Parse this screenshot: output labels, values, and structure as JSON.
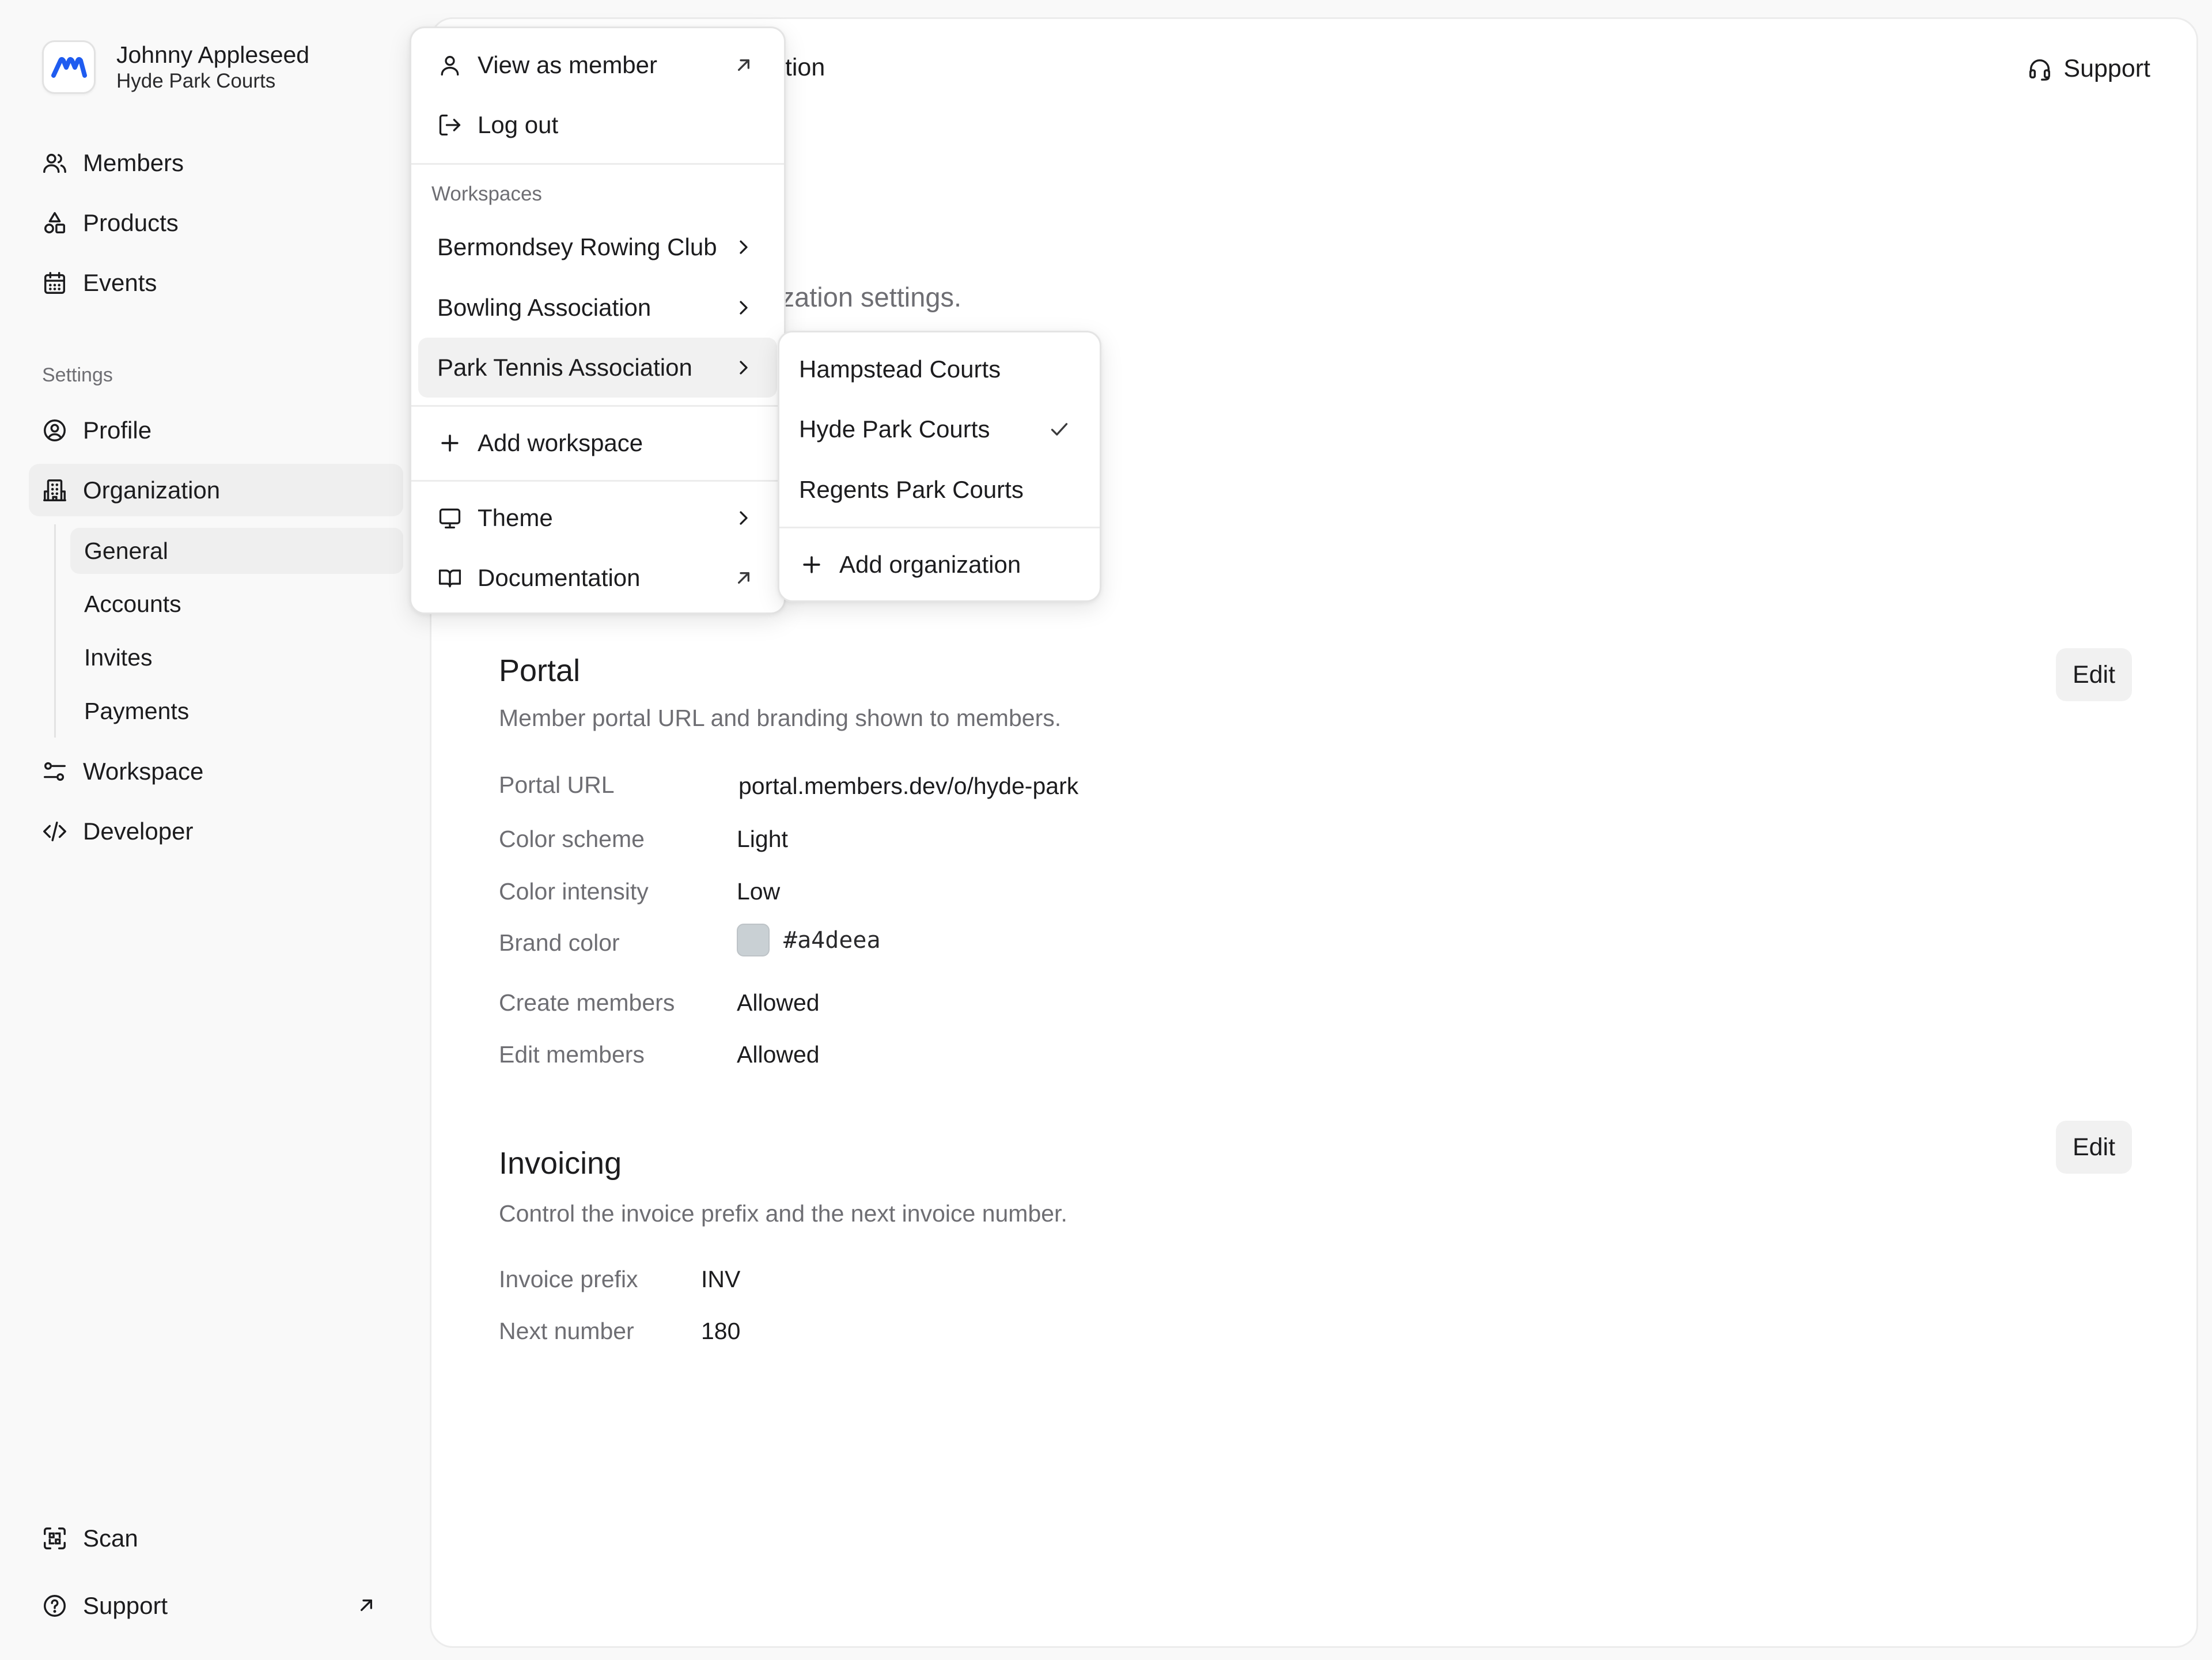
{
  "account": {
    "name": "Johnny Appleseed",
    "organization": "Hyde Park Courts"
  },
  "sidebar": {
    "nav": [
      {
        "label": "Members",
        "icon": "users-icon"
      },
      {
        "label": "Products",
        "icon": "shapes-icon"
      },
      {
        "label": "Events",
        "icon": "calendar-icon"
      }
    ],
    "settings_label": "Settings",
    "settings": [
      {
        "label": "Profile",
        "icon": "user-circle-icon"
      },
      {
        "label": "Organization",
        "icon": "building-icon"
      },
      {
        "label": "Workspace",
        "icon": "sliders-icon"
      },
      {
        "label": "Developer",
        "icon": "code-icon"
      }
    ],
    "org_subnav": [
      "General",
      "Accounts",
      "Invites",
      "Payments"
    ],
    "footer": [
      {
        "label": "Scan",
        "icon": "scan-icon"
      },
      {
        "label": "Support",
        "icon": "help-circle-icon"
      }
    ]
  },
  "topbar": {
    "title_visible": "ation",
    "support_label": "Support"
  },
  "page": {
    "subtitle_visible": "nization settings."
  },
  "portal": {
    "title": "Portal",
    "description": "Member portal URL and branding shown to members.",
    "edit_label": "Edit",
    "rows": [
      {
        "label": "Portal URL",
        "value": "portal.members.dev/o/hyde-park"
      },
      {
        "label": "Color scheme",
        "value": "Light"
      },
      {
        "label": "Color intensity",
        "value": "Low"
      },
      {
        "label": "Brand color",
        "value": "#a4deea"
      },
      {
        "label": "Create members",
        "value": "Allowed"
      },
      {
        "label": "Edit members",
        "value": "Allowed"
      }
    ]
  },
  "invoicing": {
    "title": "Invoicing",
    "description": "Control the invoice prefix and the next invoice number.",
    "edit_label": "Edit",
    "rows": [
      {
        "label": "Invoice prefix",
        "value": "INV"
      },
      {
        "label": "Next number",
        "value": "180"
      }
    ]
  },
  "account_menu": {
    "items": [
      {
        "label": "View as member",
        "icon": "user-icon",
        "trailing": "external-arrow-icon"
      },
      {
        "label": "Log out",
        "icon": "log-out-icon"
      }
    ],
    "workspaces_heading": "Workspaces",
    "workspaces": [
      {
        "label": "Bermondsey Rowing Club"
      },
      {
        "label": "Bowling Association"
      },
      {
        "label": "Park Tennis Association",
        "highlighted": true
      }
    ],
    "add_workspace": "Add workspace",
    "theme": "Theme",
    "documentation": "Documentation"
  },
  "org_submenu": {
    "items": [
      {
        "label": "Hampstead Courts",
        "selected": false
      },
      {
        "label": "Hyde Park Courts",
        "selected": true
      },
      {
        "label": "Regents Park Courts",
        "selected": false
      }
    ],
    "add_organization": "Add organization"
  },
  "colors": {
    "brand_logo": "#1f5cf0",
    "brand_swatch": "#a4deea"
  }
}
